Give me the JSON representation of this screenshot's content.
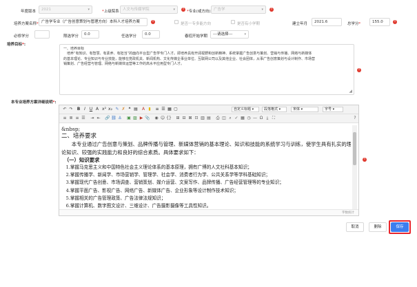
{
  "row1": {
    "year_label": "年度版本",
    "year_value": "2021",
    "parent_label": "上级院系",
    "parent_value": "人文与传媒学院",
    "major_label": "专业(或方向)",
    "major_value": "广告学"
  },
  "row2": {
    "plan_name_label": "培养方案名称",
    "plan_name_value": "广告学专业（广告创意策划与管理方向）本科人才培养方案",
    "first_major_label": "是否一专多能方向",
    "minor_label": "是否有小学期",
    "date_label": "建立年月",
    "date_value": "2021.6",
    "total_label": "总学分",
    "total_value": "155.0"
  },
  "row3": {
    "required_label": "必修学分",
    "required_value": "",
    "limited_label": "限选学分",
    "limited_value": "0.0",
    "elective_label": "任选学分",
    "elective_value": "0.0",
    "start_label": "春招开始学期",
    "start_value": "---请选择---"
  },
  "goal": {
    "label": "培养目标",
    "lines": [
      "一、培养目标",
      "　培养“有知识、有智慧、有素养、有担当”的面向平台型广告学专门人才。即培养具有开阔视野和创新精神、系统掌握广告创意与策划、营销与传播、网络与新媒体",
      "的基本理论、专业知识与专业技能，能够在党政机关、新闻机构、文化传媒企事业单位、互联网公司以及其他企业、社会团体，从事广告创意策划与设计制作、市场营",
      "销策划、广告经营与管理、网络与新媒体运营等工作的高水平应用型专门人才。"
    ]
  },
  "desc": {
    "label": "本专业培养方案详细说明",
    "font_dropdown": "宋体",
    "size_dropdown": "字号",
    "para_dropdown": "段落格式",
    "style_dropdown": "自定义标题",
    "statusbar_text": "字数统计",
    "content": [
      "&nbsp;",
      "二、培养要求",
      "　　本专业通过广告创意与策划、品牌传播与管理、新媒体营销的基本理论、知识和技能的系统学习与训练，使学生具有扎实的理",
      "论知识、较强的实践能力和良好的综合素质。具体要求如下：",
      "　（一）知识要求",
      "　1.掌握马克思主义和中国特色社会主义理论体系的基本原理，拥有广博的人文社科基本知识；",
      "　2.掌握传播学、新闻学、市场营销学、管理学、社会学、消费者行为学、公共关系学等学科基础知识；",
      "　3.掌握现代广告创意、市场调查、营销策划、媒介运营、文案写作、品牌传播、广告经营管理等的专业知识；",
      "　4.掌握平面广告、影视广告、网络广告、新媒体广告、企业形象等设计制作技术知识；",
      "　5.掌握相关的广告管理政策、广告法律法规知识；",
      "　6.掌握计算机、数字图文设计、三维设计、广告摄影摄像等工具性知识。"
    ]
  },
  "buttons": {
    "cancel": "取消",
    "delete": "删除",
    "save": "保存"
  },
  "colors": {
    "primary": "#3c7ef0",
    "highlight": "#e8242b",
    "required": "#e02020"
  }
}
